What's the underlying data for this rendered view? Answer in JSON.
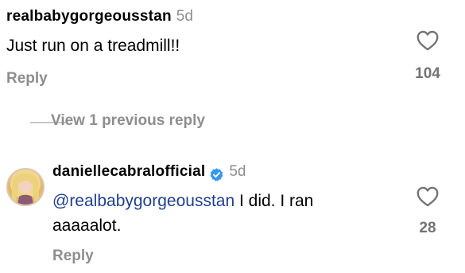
{
  "comments": [
    {
      "username": "realbabygorgeousstan",
      "time": "5d",
      "text": "Just run on a treadmill!!",
      "reply_label": "Reply",
      "like_count": "104",
      "icons": {
        "like": "heart-outline-icon"
      }
    },
    {
      "username": "daniellecabralofficial",
      "verified": true,
      "time": "5d",
      "mention": "@realbabygorgeousstan",
      "text": " I did.  I ran aaaaalot.",
      "reply_label": "Reply",
      "like_count": "28",
      "icons": {
        "like": "heart-outline-icon",
        "verified": "verified-badge-icon",
        "avatar": "avatar"
      }
    }
  ],
  "thread": {
    "view_previous_label": "View 1 previous reply"
  },
  "colors": {
    "secondary_text": "#8e8e8e",
    "mention": "#1f3f8f",
    "verified": "#3797f0"
  }
}
